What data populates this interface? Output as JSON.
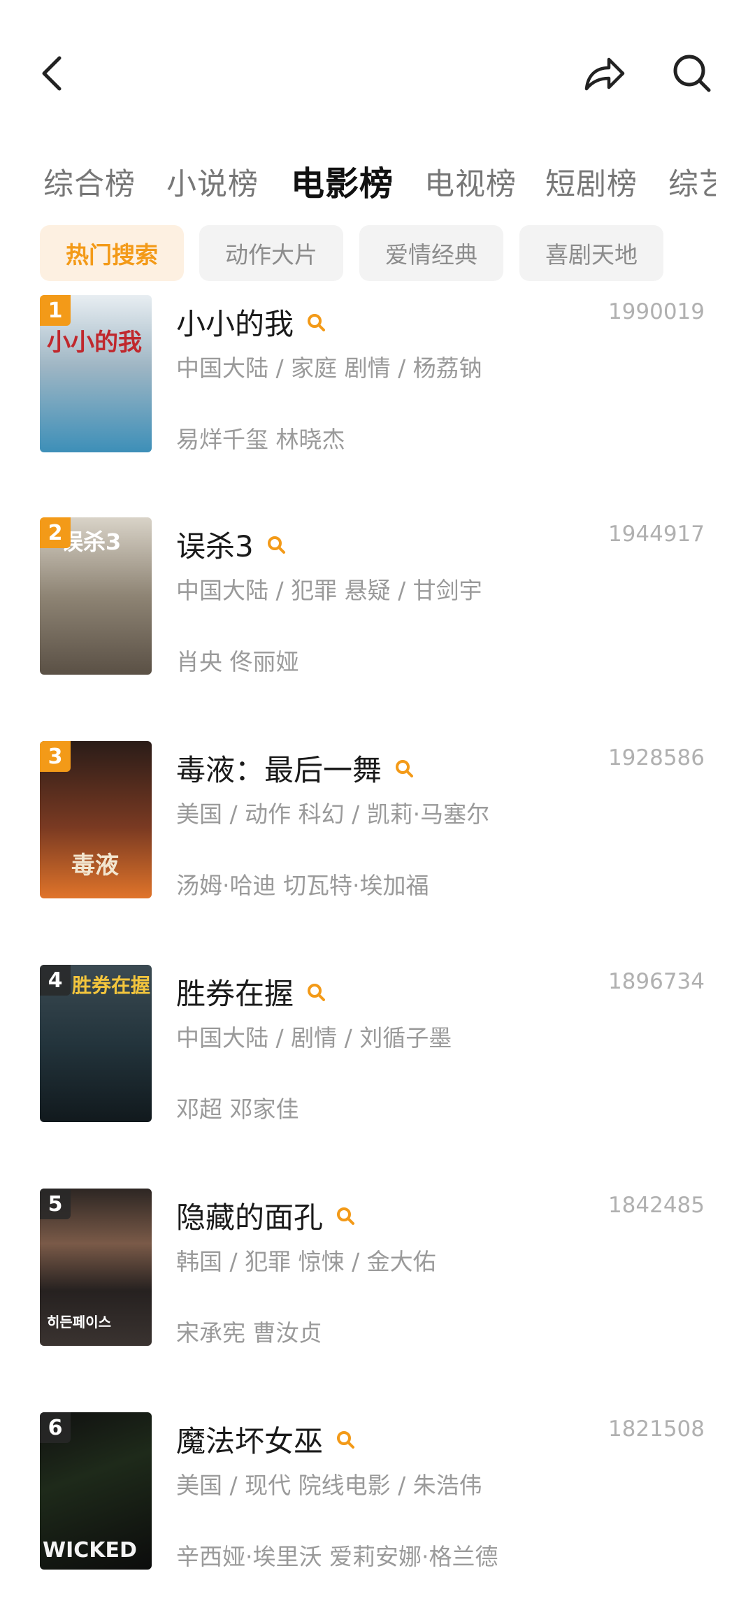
{
  "header": {
    "back_icon": "chevron-left-icon",
    "share_icon": "share-icon",
    "search_icon": "search-icon"
  },
  "tabs": [
    {
      "label": "综合榜",
      "active": false
    },
    {
      "label": "小说榜",
      "active": false
    },
    {
      "label": "电影榜",
      "active": true
    },
    {
      "label": "电视榜",
      "active": false
    },
    {
      "label": "短剧榜",
      "active": false
    },
    {
      "label": "综艺",
      "active": false
    }
  ],
  "chips": [
    {
      "label": "热门搜索",
      "active": true
    },
    {
      "label": "动作大片",
      "active": false
    },
    {
      "label": "爱情经典",
      "active": false
    },
    {
      "label": "喜剧天地",
      "active": false
    }
  ],
  "movies": [
    {
      "rank": "1",
      "title": "小小的我",
      "score": "1990019",
      "meta": "中国大陆 / 家庭 剧情 / 杨荔钠",
      "cast": "易烊千玺 林晓杰",
      "poster_text": "小小的我"
    },
    {
      "rank": "2",
      "title": "误杀3",
      "score": "1944917",
      "meta": "中国大陆 / 犯罪 悬疑 / 甘剑宇",
      "cast": "肖央 佟丽娅",
      "poster_text": "误杀3"
    },
    {
      "rank": "3",
      "title": "毒液：最后一舞",
      "score": "1928586",
      "meta": "美国 / 动作 科幻 / 凯莉·马塞尔",
      "cast": "汤姆·哈迪   切瓦特·埃加福",
      "poster_text": "毒液"
    },
    {
      "rank": "4",
      "title": "胜券在握",
      "score": "1896734",
      "meta": "中国大陆 / 剧情 / 刘循子墨",
      "cast": "邓超 邓家佳",
      "poster_text": "胜券在握"
    },
    {
      "rank": "5",
      "title": "隐藏的面孔",
      "score": "1842485",
      "meta": "韩国 / 犯罪 惊悚 / 金大佑",
      "cast": "宋承宪 曹汝贞",
      "poster_text": "히든페이스"
    },
    {
      "rank": "6",
      "title": "魔法坏女巫",
      "score": "1821508",
      "meta": "美国 / 现代 院线电影 / 朱浩伟",
      "cast": "辛西娅·埃里沃 爱莉安娜·格兰德",
      "poster_text": "WICKED"
    }
  ],
  "colors": {
    "accent": "#f39a18",
    "chip_active_bg": "#fdf0e1"
  }
}
